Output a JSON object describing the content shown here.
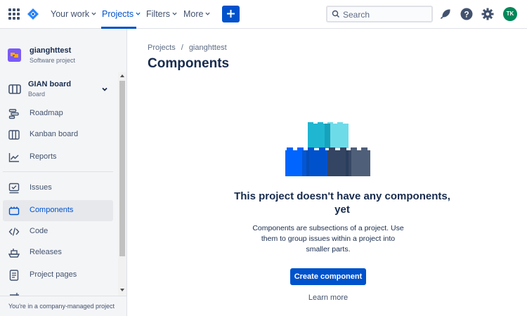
{
  "topnav": {
    "items": [
      {
        "label": "Your work"
      },
      {
        "label": "Projects"
      },
      {
        "label": "Filters"
      },
      {
        "label": "More"
      }
    ],
    "search_placeholder": "Search",
    "avatar_initials": "TK"
  },
  "sidebar": {
    "project_name": "gianghttest",
    "project_type": "Software project",
    "board_name": "GIAN board",
    "board_type": "Board",
    "items": [
      {
        "label": "Roadmap",
        "icon": "roadmap-icon"
      },
      {
        "label": "Kanban board",
        "icon": "kanban-icon"
      },
      {
        "label": "Reports",
        "icon": "reports-icon"
      },
      {
        "label": "Issues",
        "icon": "issues-icon"
      },
      {
        "label": "Components",
        "icon": "components-icon"
      },
      {
        "label": "Code",
        "icon": "code-icon"
      },
      {
        "label": "Releases",
        "icon": "releases-icon"
      },
      {
        "label": "Project pages",
        "icon": "pages-icon"
      }
    ],
    "footer": "You're in a company-managed project"
  },
  "main": {
    "breadcrumb": [
      "Projects",
      "gianghttest"
    ],
    "title": "Components",
    "empty_title": "This project doesn't have any components, yet",
    "empty_description": "Components are subsections of a project. Use them to group issues within a project into smaller parts.",
    "create_button": "Create component",
    "learn_more": "Learn more"
  },
  "colors": {
    "accent": "#0052cc",
    "sidebar_bg": "#f4f5f7",
    "text": "#172b4d",
    "avatar": "#00875a"
  }
}
